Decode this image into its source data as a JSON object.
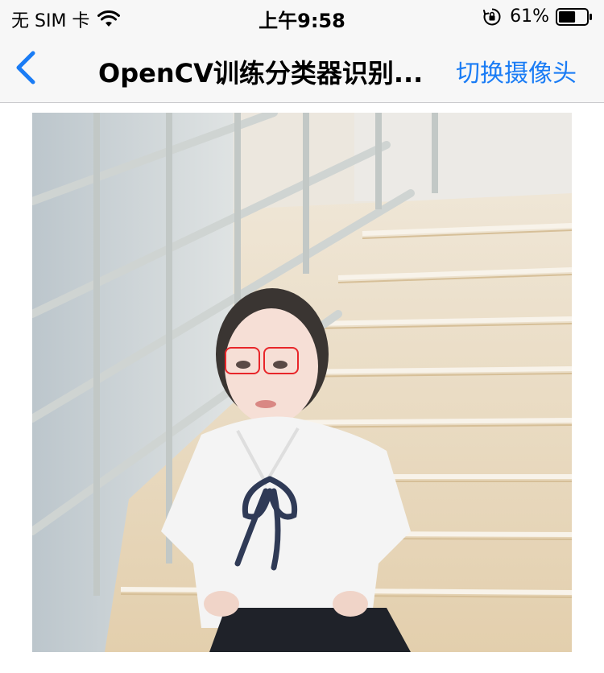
{
  "status_bar": {
    "carrier": "无 SIM 卡",
    "time": "上午9:58",
    "battery_percent": "61%",
    "battery_level": 0.61
  },
  "nav_bar": {
    "back_icon": "chevron-left-icon",
    "title": "OpenCV训练分类器识别...",
    "right_button_label": "切换摄像头"
  },
  "colors": {
    "accent": "#1a7cf5",
    "detection_box": "#e8262a"
  },
  "photo": {
    "detections": [
      {
        "label": "eye"
      },
      {
        "label": "eye"
      }
    ]
  }
}
